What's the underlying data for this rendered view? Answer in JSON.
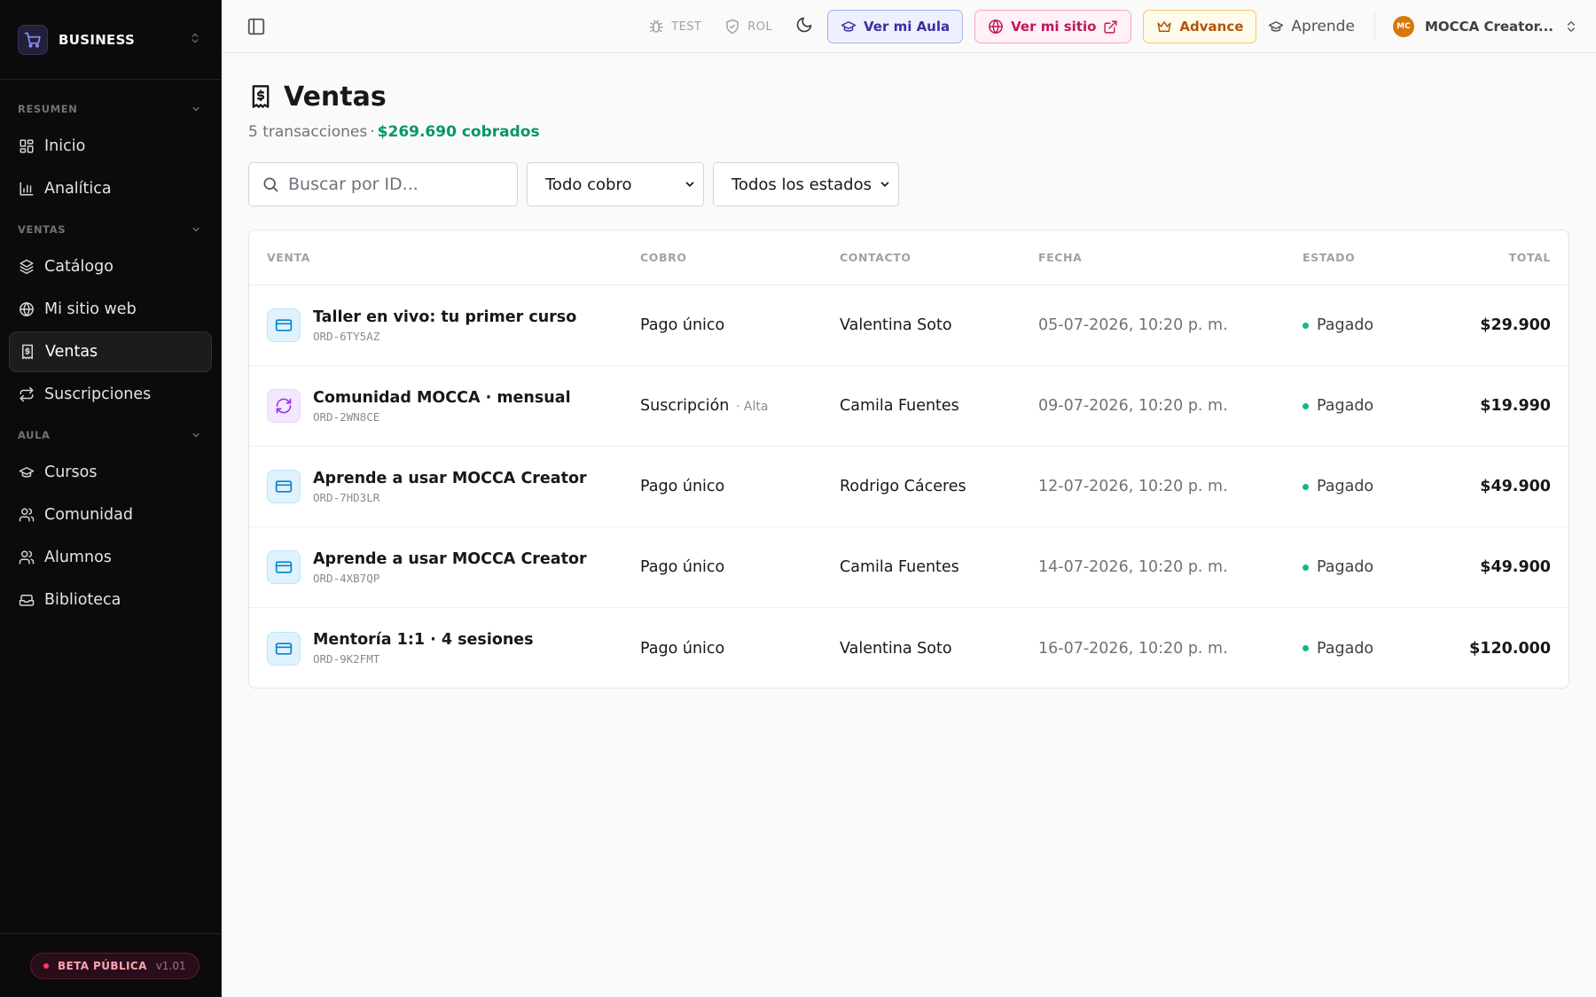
{
  "sidebar": {
    "brand": "BUSINESS",
    "sections": {
      "resumen": "RESUMEN",
      "ventas": "VENTAS",
      "aula": "AULA"
    },
    "items": {
      "inicio": "Inicio",
      "analitica": "Analítica",
      "catalogo": "Catálogo",
      "sitio": "Mi sitio web",
      "ventas": "Ventas",
      "suscripciones": "Suscripciones",
      "cursos": "Cursos",
      "comunidad": "Comunidad",
      "alumnos": "Alumnos",
      "biblioteca": "Biblioteca"
    },
    "active": "Ventas",
    "beta_label": "BETA PÚBLICA",
    "version": "v1.01"
  },
  "topbar": {
    "test": "TEST",
    "rol": "ROL",
    "ver_aula": "Ver mi Aula",
    "ver_sitio": "Ver mi sitio",
    "advance": "Advance",
    "aprende": "Aprende",
    "avatar_initials": "MC",
    "account": "MOCCA Creator..."
  },
  "page": {
    "title": "Ventas",
    "transactions": "5 transacciones",
    "separator": "·",
    "collected": "$269.690 cobrados"
  },
  "filters": {
    "search_placeholder": "Buscar por ID...",
    "cobro": "Todo cobro",
    "estado": "Todos los estados"
  },
  "table": {
    "headers": {
      "venta": "VENTA",
      "cobro": "COBRO",
      "contacto": "CONTACTO",
      "fecha": "FECHA",
      "estado": "ESTADO",
      "total": "TOTAL"
    },
    "rows": [
      {
        "name": "Taller en vivo: tu primer curso",
        "id": "ORD-6TY5AZ",
        "cobro": "Pago único",
        "extra": "",
        "contacto": "Valentina Soto",
        "fecha": "05-07-2026, 10:20 p. m.",
        "estado": "Pagado",
        "total": "$29.900",
        "icon": "card-icon"
      },
      {
        "name": "Comunidad MOCCA · mensual",
        "id": "ORD-2WN8CE",
        "cobro": "Suscripción",
        "extra": "· Alta",
        "contacto": "Camila Fuentes",
        "fecha": "09-07-2026, 10:20 p. m.",
        "estado": "Pagado",
        "total": "$19.990",
        "icon": "refresh-icon"
      },
      {
        "name": "Aprende a usar MOCCA Creator",
        "id": "ORD-7HD3LR",
        "cobro": "Pago único",
        "extra": "",
        "contacto": "Rodrigo Cáceres",
        "fecha": "12-07-2026, 10:20 p. m.",
        "estado": "Pagado",
        "total": "$49.900",
        "icon": "card-icon"
      },
      {
        "name": "Aprende a usar MOCCA Creator",
        "id": "ORD-4XB7QP",
        "cobro": "Pago único",
        "extra": "",
        "contacto": "Camila Fuentes",
        "fecha": "14-07-2026, 10:20 p. m.",
        "estado": "Pagado",
        "total": "$49.900",
        "icon": "card-icon"
      },
      {
        "name": "Mentoría 1:1 · 4 sesiones",
        "id": "ORD-9K2FMT",
        "cobro": "Pago único",
        "extra": "",
        "contacto": "Valentina Soto",
        "fecha": "16-07-2026, 10:20 p. m.",
        "estado": "Pagado",
        "total": "$120.000",
        "icon": "card-icon"
      }
    ]
  },
  "colors": {
    "sidebar_bg": "#0b0b0c",
    "accent_green": "#059669",
    "status_paid": "#10b981",
    "aula": "#3730a3",
    "sitio": "#be185d",
    "advance": "#b45309"
  }
}
